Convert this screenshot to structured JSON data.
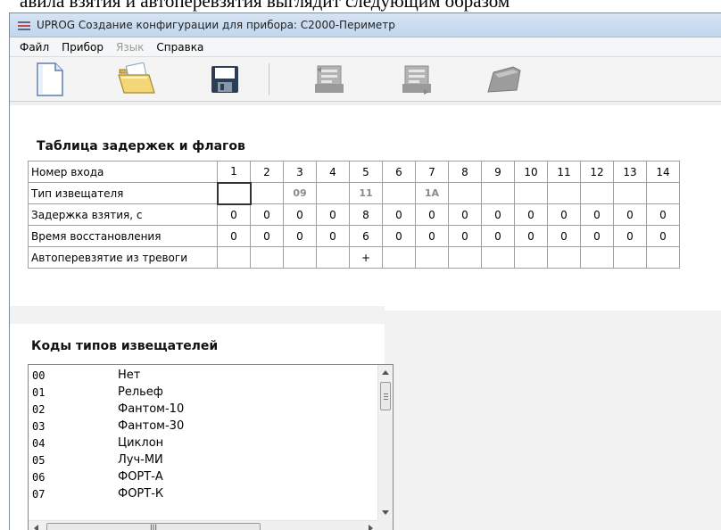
{
  "document": {
    "text_above": "авила взятия и автоперевзятия выглядит следующим образом"
  },
  "window": {
    "title": "UPROG  Создание конфигурации для прибора: С2000-Периметр"
  },
  "menu": {
    "items": [
      {
        "label": "Файл",
        "disabled": false
      },
      {
        "label": "Прибор",
        "disabled": false
      },
      {
        "label": "Язык",
        "disabled": true
      },
      {
        "label": "Справка",
        "disabled": false
      }
    ]
  },
  "toolbar": {
    "icons": [
      "new-document-icon",
      "open-folder-icon",
      "save-disk-icon",
      "read-config-icon",
      "write-config-icon",
      "device-icon"
    ]
  },
  "delay_table": {
    "title": "Таблица задержек и флагов",
    "rows": [
      {
        "label": "Номер входа",
        "values": [
          "1",
          "2",
          "3",
          "4",
          "5",
          "6",
          "7",
          "8",
          "9",
          "10",
          "11",
          "12",
          "13",
          "14"
        ]
      },
      {
        "label": "Тип извещателя",
        "values": [
          "",
          "",
          "09",
          "",
          "11",
          "",
          "1A",
          "",
          "",
          "",
          "",
          "",
          "",
          ""
        ]
      },
      {
        "label": "Задержка взятия, с",
        "values": [
          "0",
          "0",
          "0",
          "0",
          "8",
          "0",
          "0",
          "0",
          "0",
          "0",
          "0",
          "0",
          "0",
          "0"
        ]
      },
      {
        "label": "Время восстановления",
        "values": [
          "0",
          "0",
          "0",
          "0",
          "6",
          "0",
          "0",
          "0",
          "0",
          "0",
          "0",
          "0",
          "0",
          "0"
        ]
      },
      {
        "label": "Автоперевзятие из тревоги",
        "values": [
          "",
          "",
          "",
          "",
          "+",
          "",
          "",
          "",
          "",
          "",
          "",
          "",
          "",
          ""
        ]
      }
    ]
  },
  "codes_list": {
    "title": "Коды типов извещателей",
    "items": [
      {
        "code": "00",
        "name": "Нет"
      },
      {
        "code": "01",
        "name": "Рельеф"
      },
      {
        "code": "02",
        "name": "Фантом-10"
      },
      {
        "code": "03",
        "name": "Фантом-30"
      },
      {
        "code": "04",
        "name": "Циклон"
      },
      {
        "code": "05",
        "name": "Луч-МИ"
      },
      {
        "code": "06",
        "name": "ФОРТ-А"
      },
      {
        "code": "07",
        "name": "ФОРТ-К"
      }
    ],
    "hscroll_thumb_text": "III"
  },
  "colors": {
    "title_bar": "#c8daee",
    "disabled_text": "#9a9a9a",
    "type_code_text": "#8a8a8a"
  }
}
